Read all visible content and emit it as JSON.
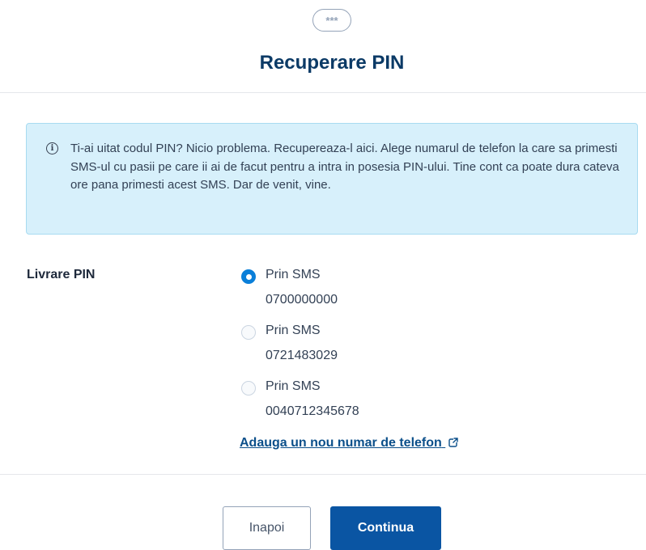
{
  "header": {
    "icon_text": "***",
    "title": "Recuperare PIN"
  },
  "info": {
    "icon": "info-circle-icon",
    "text": "Ti-ai uitat codul PIN? Nicio problema. Recupereaza-l aici. Alege numarul de telefon la care sa primesti SMS-ul cu pasii pe care ii ai de facut pentru a intra in posesia PIN-ului. Tine cont ca poate dura cateva ore pana primesti acest SMS. Dar de venit, vine."
  },
  "delivery": {
    "label": "Livrare PIN",
    "options": [
      {
        "method": "Prin SMS",
        "number": "0700000000",
        "selected": true
      },
      {
        "method": "Prin SMS",
        "number": "0721483029",
        "selected": false
      },
      {
        "method": "Prin SMS",
        "number": "0040712345678",
        "selected": false
      }
    ],
    "add_link": "Adauga un nou numar de telefon"
  },
  "buttons": {
    "back": "Inapoi",
    "continue": "Continua"
  },
  "colors": {
    "primary": "#0a55a3",
    "title": "#0b3a66",
    "radio_selected": "#0a7fd9",
    "info_bg": "#d7f0fb"
  }
}
